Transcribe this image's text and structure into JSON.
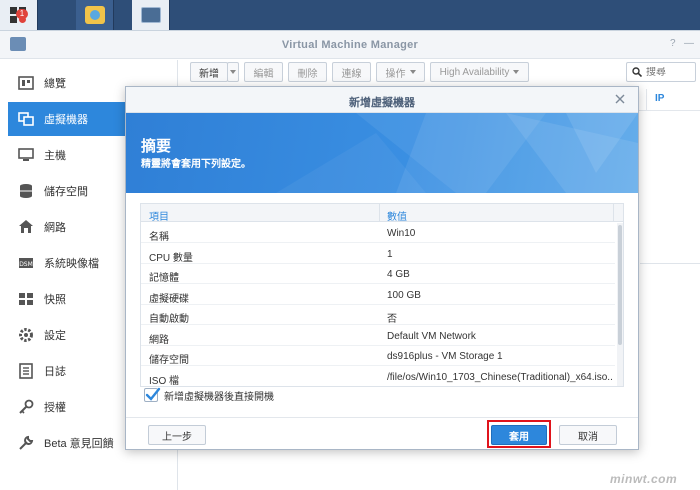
{
  "window": {
    "title": "Virtual Machine Manager"
  },
  "taskbar": {
    "badge_count": "1"
  },
  "sidebar": {
    "items": [
      {
        "label": "總覽",
        "icon": "overview-icon"
      },
      {
        "label": "虛擬機器",
        "icon": "vm-icon"
      },
      {
        "label": "主機",
        "icon": "host-icon"
      },
      {
        "label": "儲存空間",
        "icon": "storage-icon"
      },
      {
        "label": "網路",
        "icon": "network-icon"
      },
      {
        "label": "系統映像檔",
        "icon": "image-icon"
      },
      {
        "label": "快照",
        "icon": "snapshot-icon"
      },
      {
        "label": "設定",
        "icon": "gear-icon"
      },
      {
        "label": "日誌",
        "icon": "log-icon"
      },
      {
        "label": "授權",
        "icon": "key-icon"
      },
      {
        "label": "Beta 意見回饋",
        "icon": "wrench-icon"
      }
    ]
  },
  "toolbar": {
    "create": "新增",
    "edit": "編輯",
    "delete": "刪除",
    "connect": "連線",
    "action": "操作",
    "ha": "High Availability",
    "search_placeholder": "搜尋"
  },
  "grid": {
    "ip_header": "IP"
  },
  "modal": {
    "title": "新增虛擬機器",
    "banner_title": "摘要",
    "banner_subtitle": "精靈將會套用下列設定。",
    "table": {
      "headers": [
        "項目",
        "數值"
      ],
      "rows": [
        [
          "名稱",
          "Win10"
        ],
        [
          "CPU 數量",
          "1"
        ],
        [
          "記憶體",
          "4 GB"
        ],
        [
          "虛擬硬碟",
          "100 GB"
        ],
        [
          "自動啟動",
          "否"
        ],
        [
          "網路",
          "Default VM Network"
        ],
        [
          "儲存空間",
          "ds916plus - VM Storage 1"
        ],
        [
          "ISO 檔",
          "/file/os/Win10_1703_Chinese(Traditional)_x64.iso..."
        ]
      ]
    },
    "checkbox_label": "新增虛擬機器後直接開機",
    "checkbox_checked": true,
    "back_label": "上一步",
    "apply_label": "套用",
    "cancel_label": "取消"
  },
  "watermark": "minwt.com"
}
